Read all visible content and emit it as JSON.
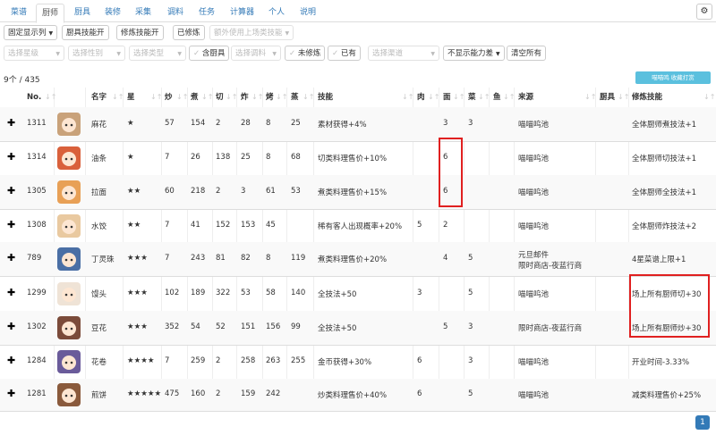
{
  "tabs": [
    {
      "label": "菜谱",
      "active": false
    },
    {
      "label": "厨师",
      "active": true
    },
    {
      "label": "厨具",
      "active": false
    },
    {
      "label": "装修",
      "active": false
    },
    {
      "label": "采集",
      "active": false
    },
    {
      "label": "调料",
      "active": false
    },
    {
      "label": "任务",
      "active": false
    },
    {
      "label": "计算器",
      "active": false
    },
    {
      "label": "个人",
      "active": false
    },
    {
      "label": "说明",
      "active": false
    }
  ],
  "toolbar1": {
    "fixed_columns": "固定显示列",
    "equip_skill": "厨具技能开",
    "ultimate_skill": "修炼技能开",
    "cultivated": "已修炼",
    "extra_equip": "额外使用上场类技能"
  },
  "toolbar2": {
    "star_filter": "选择星级",
    "gender_filter": "选择性别",
    "type_filter": "选择类型",
    "has_equip": "含厨具",
    "seasoning_filter": "选择调料",
    "not_cultivated": "未修炼",
    "owned": "已有",
    "source_filter": "选择渠道",
    "hide_diff": "不显示能力差",
    "clear_all": "清空所有"
  },
  "count": "9个 / 435",
  "tooltip": "喵喵鸣 收藏打赏",
  "columns": {
    "no": "No.",
    "name": "名字",
    "star": "星",
    "stirfry": "炒",
    "boil": "煮",
    "knife": "切",
    "fry": "炸",
    "bake": "烤",
    "steam": "蒸",
    "skill": "技能",
    "meat": "肉",
    "flour": "面",
    "veg": "菜",
    "fish": "鱼",
    "source": "来源",
    "equip": "厨具",
    "ultimate": "修炼技能"
  },
  "rows": [
    {
      "no": "1311",
      "name": "麻花",
      "star": "★",
      "stirfry": "57",
      "boil": "154",
      "knife": "2",
      "fry": "28",
      "bake": "8",
      "steam": "25",
      "skill": "素材获得+4%",
      "meat": "",
      "flour": "3",
      "veg": "3",
      "fish": "",
      "source": "喵喵呜池",
      "source2": "",
      "ultimate": "全体厨师煮技法+1",
      "avatar_color": "#c9a27a"
    },
    {
      "no": "1314",
      "name": "油条",
      "star": "★",
      "stirfry": "7",
      "boil": "26",
      "knife": "138",
      "fry": "25",
      "bake": "8",
      "steam": "68",
      "skill": "切类料理售价+10%",
      "meat": "",
      "flour": "6",
      "veg": "",
      "fish": "",
      "source": "喵喵呜池",
      "source2": "",
      "ultimate": "全体厨师切技法+1",
      "avatar_color": "#d9603b"
    },
    {
      "no": "1305",
      "name": "拉面",
      "star": "★★",
      "stirfry": "60",
      "boil": "218",
      "knife": "2",
      "fry": "3",
      "bake": "61",
      "steam": "53",
      "skill": "煮类料理售价+15%",
      "meat": "",
      "flour": "6",
      "veg": "",
      "fish": "",
      "source": "喵喵呜池",
      "source2": "",
      "ultimate": "全体厨师全技法+1",
      "avatar_color": "#e8a056"
    },
    {
      "no": "1308",
      "name": "水饺",
      "star": "★★",
      "stirfry": "7",
      "boil": "41",
      "knife": "152",
      "fry": "153",
      "bake": "45",
      "steam": "",
      "skill": "稀有客人出现概率+20%",
      "meat": "5",
      "flour": "2",
      "veg": "",
      "fish": "",
      "source": "喵喵呜池",
      "source2": "",
      "ultimate": "全体厨师炸技法+2",
      "avatar_color": "#e9c9a0"
    },
    {
      "no": "789",
      "name": "丁灵珠",
      "star": "★★★",
      "stirfry": "7",
      "boil": "243",
      "knife": "81",
      "fry": "82",
      "bake": "8",
      "steam": "119",
      "skill": "煮类料理售价+20%",
      "meat": "",
      "flour": "4",
      "veg": "5",
      "fish": "",
      "source": "元旦邮件",
      "source2": "限时商店-夜蓝行商",
      "ultimate": "4星菜谱上限+1",
      "avatar_color": "#4a6fa5"
    },
    {
      "no": "1299",
      "name": "馒头",
      "star": "★★★",
      "stirfry": "102",
      "boil": "189",
      "knife": "322",
      "fry": "53",
      "bake": "58",
      "steam": "140",
      "skill": "全技法+50",
      "meat": "3",
      "flour": "",
      "veg": "5",
      "fish": "",
      "source": "喵喵呜池",
      "source2": "",
      "ultimate": "场上所有厨师切+30",
      "avatar_color": "#efe3d6"
    },
    {
      "no": "1302",
      "name": "豆花",
      "star": "★★★",
      "stirfry": "352",
      "boil": "54",
      "knife": "52",
      "fry": "151",
      "bake": "156",
      "steam": "99",
      "skill": "全技法+50",
      "meat": "",
      "flour": "5",
      "veg": "3",
      "fish": "",
      "source": "限时商店-夜蓝行商",
      "source2": "",
      "ultimate": "场上所有厨师炒+30",
      "avatar_color": "#7b4b3a"
    },
    {
      "no": "1284",
      "name": "花卷",
      "star": "★★★★",
      "stirfry": "7",
      "boil": "259",
      "knife": "2",
      "fry": "258",
      "bake": "263",
      "steam": "255",
      "skill": "金币获得+30%",
      "meat": "6",
      "flour": "",
      "veg": "3",
      "fish": "",
      "source": "喵喵呜池",
      "source2": "",
      "ultimate": "开业时间-3.33%",
      "avatar_color": "#6a5b9a"
    },
    {
      "no": "1281",
      "name": "煎饼",
      "star": "★★★★★",
      "stirfry": "475",
      "boil": "160",
      "knife": "2",
      "fry": "159",
      "bake": "242",
      "steam": "",
      "skill": "炒类料理售价+40%",
      "meat": "6",
      "flour": "",
      "veg": "5",
      "fish": "",
      "source": "喵喵呜池",
      "source2": "",
      "ultimate": "减类料理售价+25%",
      "avatar_color": "#8a5a3c"
    }
  ],
  "pagination": {
    "current": "1"
  },
  "colors": {
    "accent": "#337ab7",
    "highlight_border": "#e02020",
    "tooltip_bg": "#5bc0de"
  }
}
